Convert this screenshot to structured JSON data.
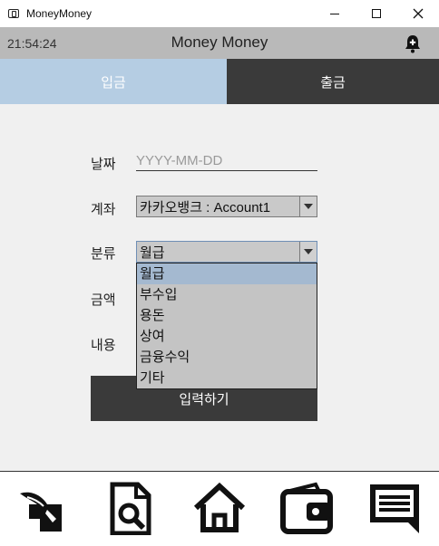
{
  "window": {
    "title": "MoneyMoney"
  },
  "header": {
    "clock": "21:54:24",
    "title": "Money Money",
    "notification_icon": "bell-plus-icon"
  },
  "tabs": [
    {
      "label": "입금",
      "active": true
    },
    {
      "label": "출금",
      "active": false
    }
  ],
  "form": {
    "date_label": "날짜",
    "date_placeholder": "YYYY-MM-DD",
    "date_value": "",
    "account_label": "계좌",
    "account_value": "카카오뱅크 : Account1",
    "category_label": "분류",
    "category_value": "월급",
    "category_options": [
      "월급",
      "부수입",
      "용돈",
      "상여",
      "금융수익",
      "기타"
    ],
    "amount_label": "금액",
    "memo_label": "내용",
    "submit_label": "입력하기"
  },
  "bottom_nav": [
    {
      "icon": "write-entry-icon"
    },
    {
      "icon": "search-document-icon"
    },
    {
      "icon": "home-icon"
    },
    {
      "icon": "wallet-icon"
    },
    {
      "icon": "message-icon"
    }
  ],
  "colors": {
    "tab_active": "#b5cde3",
    "tab_inactive": "#3a3a3a",
    "header_bg": "#b9b9b9",
    "dropdown_selected": "#a4b9d0"
  }
}
